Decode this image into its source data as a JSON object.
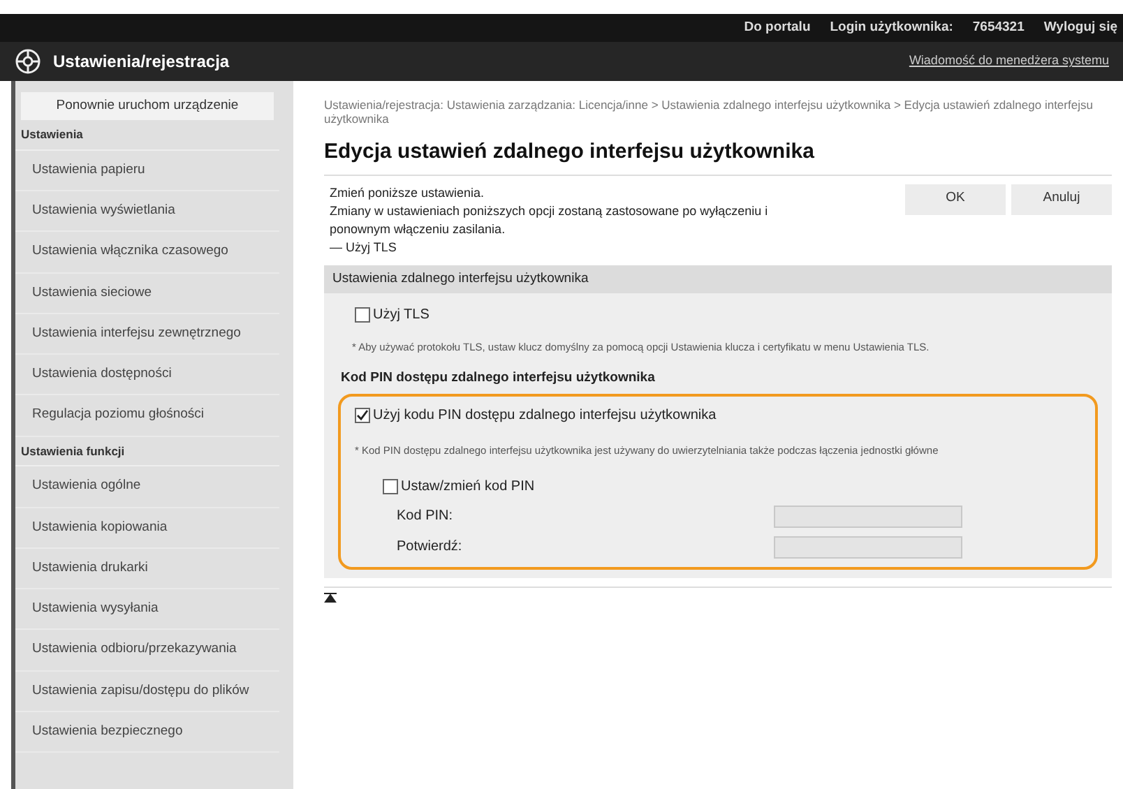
{
  "top_bar": {
    "links": [
      "Do portalu",
      "Login użytkownika:",
      "7654321",
      "Wyloguj się"
    ]
  },
  "header": {
    "title": "Ustawienia/rejestracja",
    "message_link": "Wiadomość do menedżera systemu"
  },
  "sidebar": {
    "restart_button": "Ponownie uruchom urządzenie",
    "items": [
      {
        "kind": "heading",
        "label": "Ustawienia"
      },
      {
        "kind": "item",
        "label": "Ustawienia papieru"
      },
      {
        "kind": "item",
        "label": "Ustawienia wyświetlania"
      },
      {
        "kind": "item",
        "label": "Ustawienia włącznika czasowego"
      },
      {
        "kind": "item",
        "label": "Ustawienia sieciowe"
      },
      {
        "kind": "item",
        "label": "Ustawienia interfejsu zewnętrznego"
      },
      {
        "kind": "item",
        "label": "Ustawienia dostępności"
      },
      {
        "kind": "item",
        "label": "Regulacja poziomu głośności"
      },
      {
        "kind": "heading",
        "label": "Ustawienia funkcji"
      },
      {
        "kind": "item",
        "label": "Ustawienia ogólne"
      },
      {
        "kind": "item",
        "label": "Ustawienia kopiowania"
      },
      {
        "kind": "item",
        "label": "Ustawienia drukarki"
      },
      {
        "kind": "item",
        "label": "Ustawienia wysyłania"
      },
      {
        "kind": "item",
        "label": "Ustawienia odbioru/przekazywania"
      },
      {
        "kind": "item",
        "label": "Ustawienia zapisu/dostępu do plików"
      },
      {
        "kind": "item",
        "label": "Ustawienia bezpiecznego"
      }
    ]
  },
  "main": {
    "breadcrumb": "Ustawienia/rejestracja: Ustawienia zarządzania: Licencja/inne > Ustawienia zdalnego interfejsu użytkownika > Edycja ustawień zdalnego interfejsu użytkownika",
    "title": "Edycja ustawień zdalnego interfejsu użytkownika",
    "intro": [
      "Zmień poniższe ustawienia.",
      "Zmiany w ustawieniach poniższych opcji zostaną zastosowane po wyłączeniu i ponownym włączeniu zasilania.",
      "— Użyj TLS"
    ],
    "buttons": [
      "OK",
      "Anuluj"
    ],
    "section_title": "Ustawienia zdalnego interfejsu użytkownika",
    "use_tls": {
      "label": "Użyj TLS",
      "checked": false
    },
    "tls_note": "* Aby używać protokołu TLS, ustaw klucz domyślny za pomocą opcji Ustawienia klucza i certyfikatu w menu Ustawienia TLS.",
    "pin_heading": "Kod PIN dostępu zdalnego interfejsu użytkownika",
    "use_pin": {
      "label": "Użyj kodu PIN dostępu zdalnego interfejsu użytkownika",
      "checked": true
    },
    "pin_note": "* Kod PIN dostępu zdalnego interfejsu użytkownika jest używany do uwierzytelniania także podczas łączenia jednostki główne",
    "set_pin": {
      "label": "Ustaw/zmień kod PIN",
      "checked": false
    },
    "fields": [
      {
        "label": "Kod PIN:",
        "disabled": true
      },
      {
        "label": "Potwierdź:",
        "disabled": true
      }
    ],
    "highlighted": true
  }
}
